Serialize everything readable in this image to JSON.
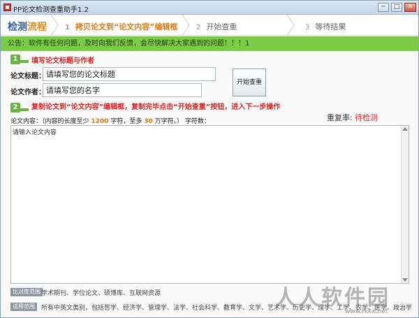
{
  "window": {
    "title": "PP论文检测查重助手1.2",
    "controls": {
      "minimize": "─",
      "maximize": "□",
      "close": "✕"
    }
  },
  "steps": {
    "current_prefix": "检测",
    "current_highlight": "流程",
    "items": [
      {
        "num": "1",
        "label": "拷贝论文到“论文内容”编辑框",
        "active": true
      },
      {
        "num": "2",
        "label": "开始查重",
        "active": false
      },
      {
        "num": "3",
        "label": "等待结果",
        "active": false
      }
    ]
  },
  "notice": "公告：软件有任何问题，及时向我们反馈，会尽快解决大家遇到的问题！！！1",
  "section1": {
    "num": "1",
    "instruction": "填写论文标题与作者"
  },
  "form": {
    "title_label": "论文标题：",
    "title_value": "请填写您的论文标题",
    "author_label": "论文作者：",
    "author_value": "请填写您的名字",
    "start_button": "开始查重"
  },
  "section2": {
    "num": "2",
    "instruction": "复制论文到“论文内容”编辑框，复制完毕点击“开始查重”按钮，进入下一步操作"
  },
  "result": {
    "repeat_label": "重复率:",
    "repeat_value": "待检测"
  },
  "content": {
    "label_pre": "论文内容：（内容的长度至少",
    "min_chars": "1200",
    "label_mid": "字符，至多",
    "max_chars": "30",
    "label_post": "万字符。）  字符数：",
    "placeholder": "请输入论文内容"
  },
  "footer": {
    "compare_tag": "比对库范围",
    "compare_text": "学术期刊、学位论文、硕博库、互联网资源",
    "scope_tag": "适用范围",
    "scope_text": "所有中英文类别，包括哲学、经济学、管理学、法学、社会科学、教育学、文学、艺术学、历史学、理学、工学、农学、医学、政治学、军事学等"
  },
  "watermark": {
    "text": "人人软件园",
    "url": "www.rkkx.net"
  },
  "colors": {
    "accent_green": "#7ccb47",
    "highlight_orange": "#e07a10",
    "warn_red": "#d22222",
    "brand_blue": "#2f5da8"
  }
}
